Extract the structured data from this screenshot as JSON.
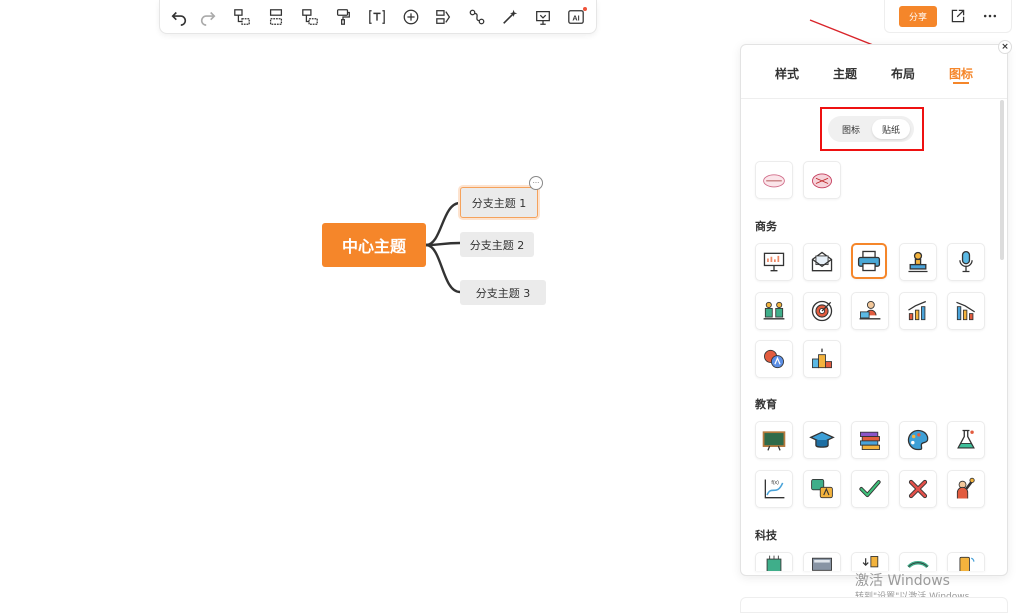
{
  "toolbar": {
    "items": [
      "undo-icon",
      "redo-icon",
      "insert-child-icon",
      "insert-sibling-icon",
      "insert-parent-icon",
      "format-painter-icon",
      "text-box-icon",
      "add-circle-icon",
      "summary-icon",
      "relationship-icon",
      "style-magic-icon",
      "outline-icon",
      "ai-icon"
    ],
    "ai_label": "AI"
  },
  "header": {
    "share_label": "分享",
    "export_icon": "export-icon",
    "more_icon": "more-dots-icon"
  },
  "mindmap": {
    "central_topic": "中心主题",
    "branches": [
      "分支主题 1",
      "分支主题 2",
      "分支主题 3"
    ],
    "more_marker": "···"
  },
  "panel": {
    "tabs": [
      {
        "label": "样式"
      },
      {
        "label": "主题"
      },
      {
        "label": "布局"
      },
      {
        "label": "图标"
      }
    ],
    "active_tab": "图标",
    "segment": {
      "options": [
        "图标",
        "贴纸"
      ],
      "selected": "贴纸"
    },
    "categories": [
      "商务",
      "教育",
      "科技"
    ],
    "close_label": "×"
  },
  "watermark": {
    "line1": "激活 Windows",
    "line2": "转到\"设置\"以激活 Windows。"
  },
  "colors": {
    "accent": "#f5862a",
    "highlight_box": "#e11111",
    "arrow": "#d9242a"
  }
}
